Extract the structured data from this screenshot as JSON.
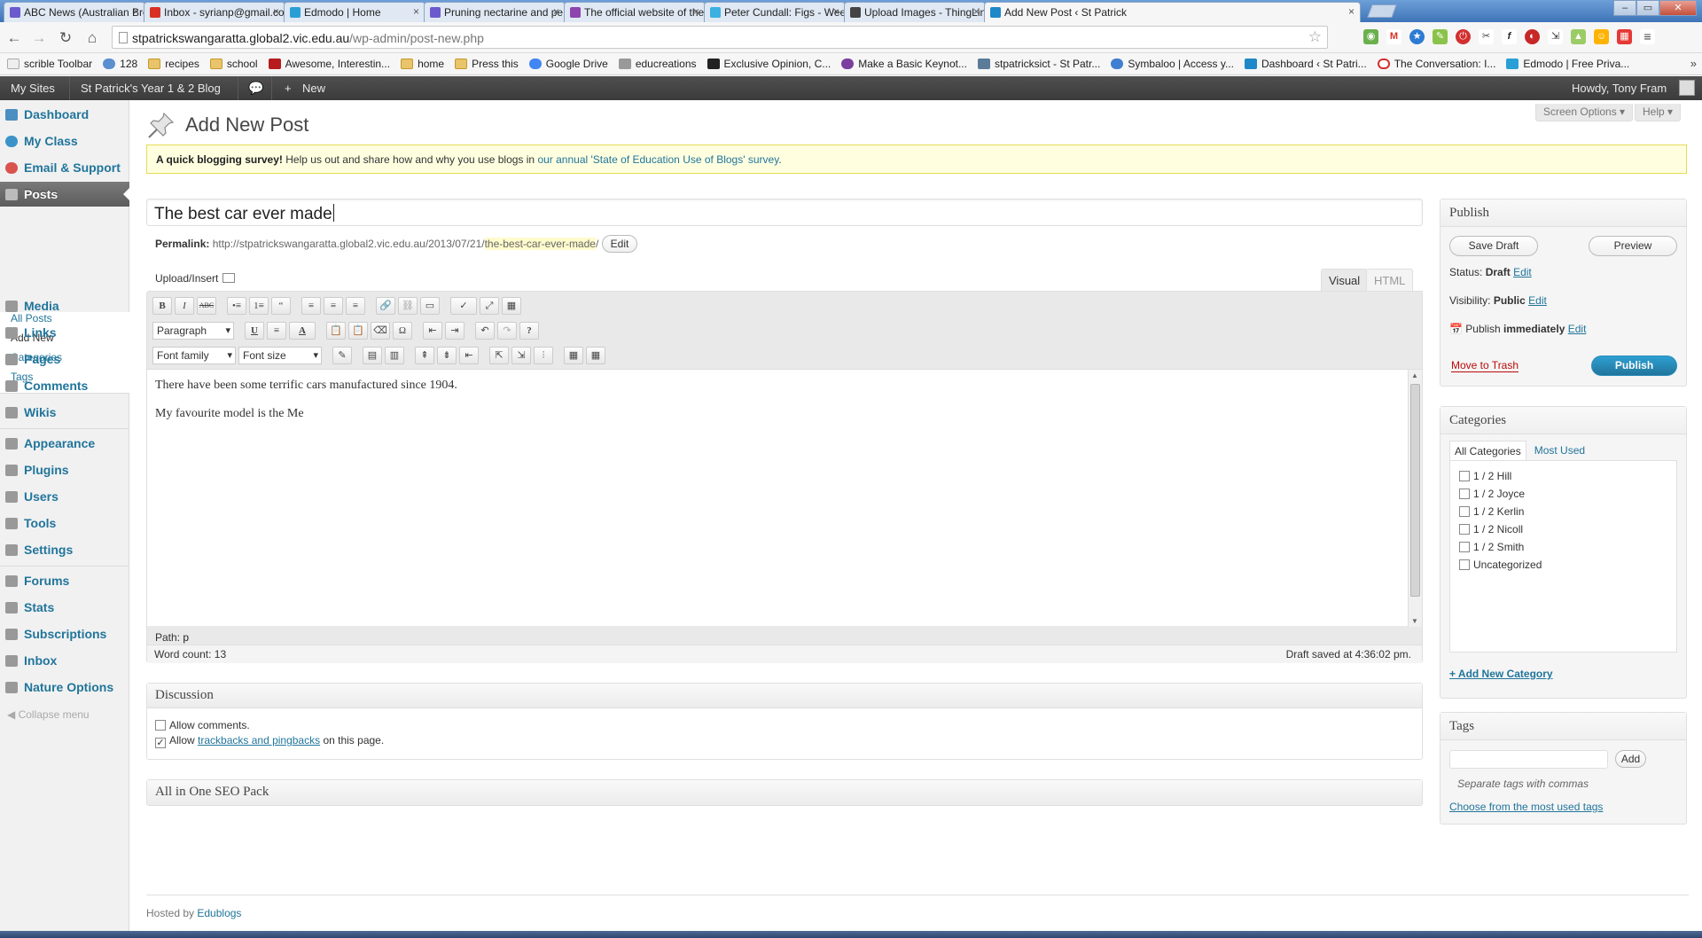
{
  "browser": {
    "tabs": [
      {
        "label": "ABC News (Australian Bro",
        "color": "#6a5acd"
      },
      {
        "label": "Inbox - syrianp@gmail.co",
        "color": "#d93025"
      },
      {
        "label": "Edmodo | Home",
        "color": "#2a9fd6"
      },
      {
        "label": "Pruning nectarine and pe",
        "color": "#6a5acd"
      },
      {
        "label": "The official website of the",
        "color": "#8e44ad"
      },
      {
        "label": "Peter Cundall: Figs - Week",
        "color": "#3cb0e0"
      },
      {
        "label": "Upload Images - ThingLin",
        "color": "#444444"
      },
      {
        "label": "Add New Post ‹ St Patrick",
        "color": "#1e88c8"
      }
    ],
    "close_glyph": "×",
    "url_host": "stpatrickswangaratta.global2.vic.edu.au",
    "url_path": "/wp-admin/post-new.php",
    "bookmarks": [
      {
        "label": "scrible Toolbar",
        "icon": "page-icon"
      },
      {
        "label": "128",
        "icon": "app-icon"
      },
      {
        "label": "recipes",
        "icon": "folder-icon"
      },
      {
        "label": "school",
        "icon": "folder-icon"
      },
      {
        "label": "Awesome, Interestin...",
        "icon": "bookmark-icon"
      },
      {
        "label": "home",
        "icon": "folder-icon"
      },
      {
        "label": "Press this",
        "icon": "folder-icon"
      },
      {
        "label": "Google Drive",
        "icon": "google-icon"
      },
      {
        "label": "educreations",
        "icon": "app-icon"
      },
      {
        "label": "Exclusive Opinion, C...",
        "icon": "page-icon"
      },
      {
        "label": "Make a Basic Keynot...",
        "icon": "app-icon"
      },
      {
        "label": "stpatricksict - St Patr...",
        "icon": "app-icon"
      },
      {
        "label": "Symbaloo | Access y...",
        "icon": "app-icon"
      },
      {
        "label": "Dashboard ‹ St Patri...",
        "icon": "wordpress-icon"
      },
      {
        "label": "The Conversation: I...",
        "icon": "app-icon"
      },
      {
        "label": "Edmodo | Free Priva...",
        "icon": "edmodo-icon"
      }
    ],
    "more_glyph": "»"
  },
  "adminbar": {
    "my_sites": "My Sites",
    "site_name": "St Patrick's Year 1 & 2 Blog",
    "new_label": "New",
    "howdy": "Howdy, Tony Fram"
  },
  "menu": {
    "items": [
      {
        "label": "Dashboard",
        "icon": "dashboard-icon",
        "color": "#4a8ec2"
      },
      {
        "label": "My Class",
        "icon": "class-icon",
        "color": "#3b93c9"
      },
      {
        "label": "Email & Support",
        "icon": "email-icon",
        "color": "#d9534f"
      },
      {
        "label": "Posts",
        "icon": "pin-icon",
        "color": "#888888"
      },
      {
        "label": "Media",
        "icon": "media-icon",
        "color": "#888888"
      },
      {
        "label": "Links",
        "icon": "link-icon",
        "color": "#888888"
      },
      {
        "label": "Pages",
        "icon": "pages-icon",
        "color": "#888888"
      },
      {
        "label": "Comments",
        "icon": "comments-icon",
        "color": "#888888"
      },
      {
        "label": "Wikis",
        "icon": "wiki-icon",
        "color": "#888888"
      },
      {
        "label": "Appearance",
        "icon": "appearance-icon",
        "color": "#888888"
      },
      {
        "label": "Plugins",
        "icon": "plugin-icon",
        "color": "#888888"
      },
      {
        "label": "Users",
        "icon": "users-icon",
        "color": "#888888"
      },
      {
        "label": "Tools",
        "icon": "tools-icon",
        "color": "#888888"
      },
      {
        "label": "Settings",
        "icon": "settings-icon",
        "color": "#888888"
      },
      {
        "label": "Forums",
        "icon": "forums-icon",
        "color": "#888888"
      },
      {
        "label": "Stats",
        "icon": "stats-icon",
        "color": "#888888"
      },
      {
        "label": "Subscriptions",
        "icon": "subscriptions-icon",
        "color": "#888888"
      },
      {
        "label": "Inbox",
        "icon": "inbox-icon",
        "color": "#888888"
      },
      {
        "label": "Nature Options",
        "icon": "nature-icon",
        "color": "#888888"
      }
    ],
    "posts_submenu": [
      "All Posts",
      "Add New",
      "Categories",
      "Tags"
    ],
    "collapse": "Collapse menu"
  },
  "screen": {
    "options": "Screen Options ▾",
    "help": "Help ▾",
    "title": "Add New Post"
  },
  "notice": {
    "bold": "A quick blogging survey!",
    "text": "Help us out and share how and why you use blogs in",
    "link": "our annual 'State of Education Use of Blogs' survey",
    "end": "."
  },
  "post": {
    "title": "The best car ever made",
    "permalink_label": "Permalink:",
    "permalink_base": "http://stpatrickswangaratta.global2.vic.edu.au/2013/07/21/",
    "permalink_slug": "the-best-car-ever-made",
    "permalink_end": "/",
    "edit": "Edit"
  },
  "editor": {
    "upload_insert": "Upload/Insert",
    "visual": "Visual",
    "html": "HTML",
    "row1": [
      "B",
      "I",
      "ABC",
      "•≡",
      "1≡",
      "“",
      "≡",
      "≡",
      "≡",
      "🔗",
      "⛓",
      "▭",
      "✓",
      "⤢",
      "▦"
    ],
    "row2_format": "Paragraph",
    "row2": [
      "U",
      "≡",
      "A",
      "📋",
      "📋",
      "⌫",
      "Ω",
      "⇤",
      "⇥",
      "↶",
      "↷",
      "?"
    ],
    "font_family": "Font family",
    "font_size": "Font size",
    "row3": [
      "✎",
      "▤",
      "▥",
      "⇞",
      "⇟",
      "⇤",
      "⇱",
      "⇲",
      "⫶",
      "▦",
      "▦"
    ],
    "content": [
      "There have been some terrific cars manufactured since 1904.",
      "My favourite model is the Me"
    ],
    "path_label": "Path:",
    "path_value": "p",
    "word_count": "Word count: 13",
    "draft_saved": "Draft saved at 4:36:02 pm."
  },
  "discussion": {
    "title": "Discussion",
    "allow_comments": "Allow comments.",
    "allow_prefix": "Allow",
    "trackbacks_link": "trackbacks and pingbacks",
    "allow_suffix": "on this page.",
    "check": "✓"
  },
  "seo": {
    "title": "All in One SEO Pack"
  },
  "publish": {
    "title": "Publish",
    "save_draft": "Save Draft",
    "preview": "Preview",
    "status_label": "Status:",
    "status_value": "Draft",
    "visibility_label": "Visibility:",
    "visibility_value": "Public",
    "publish_label": "Publish",
    "publish_value": "immediately",
    "edit": "Edit",
    "trash": "Move to Trash",
    "publish_button": "Publish"
  },
  "categories": {
    "title": "Categories",
    "tab_all": "All Categories",
    "tab_most": "Most Used",
    "items": [
      "1 / 2 Hill",
      "1 / 2 Joyce",
      "1 / 2 Kerlin",
      "1 / 2 Nicoll",
      "1 / 2 Smith",
      "Uncategorized"
    ],
    "add_new": "+ Add New Category"
  },
  "tags": {
    "title": "Tags",
    "add": "Add",
    "hint": "Separate tags with commas",
    "choose": "Choose from the most used tags"
  },
  "footer": {
    "hosted_by": "Hosted by",
    "host": "Edublogs"
  }
}
